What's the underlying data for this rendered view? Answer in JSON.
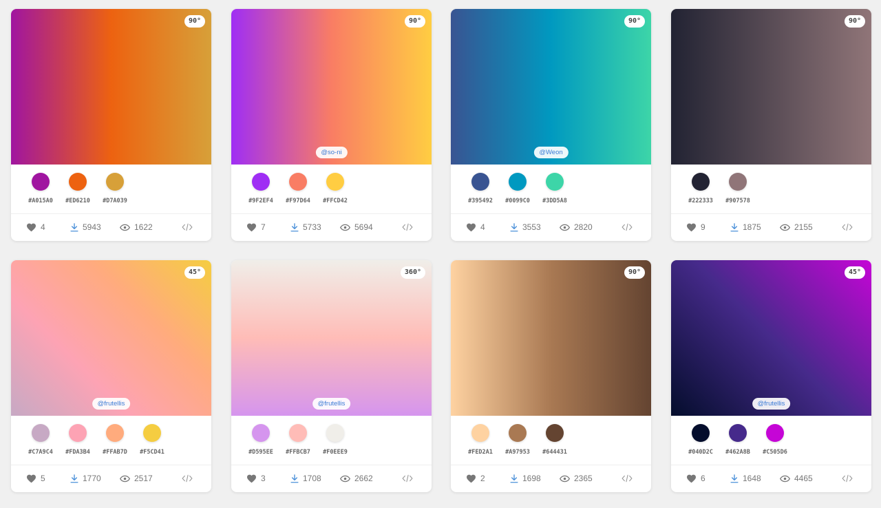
{
  "cards": [
    {
      "angle": "90°",
      "author": "",
      "gradient": "linear-gradient(90deg,#A015A0,#ED6210,#D7A039)",
      "colors": [
        {
          "hex": "#A015A0"
        },
        {
          "hex": "#ED6210"
        },
        {
          "hex": "#D7A039"
        }
      ],
      "likes": "4",
      "downloads": "5943",
      "views": "1622"
    },
    {
      "angle": "90°",
      "author": "@so-ni",
      "gradient": "linear-gradient(90deg,#9F2EF4,#F97D64,#FFCD42)",
      "colors": [
        {
          "hex": "#9F2EF4"
        },
        {
          "hex": "#F97D64"
        },
        {
          "hex": "#FFCD42"
        }
      ],
      "likes": "7",
      "downloads": "5733",
      "views": "5694"
    },
    {
      "angle": "90°",
      "author": "@Weon",
      "gradient": "linear-gradient(90deg,#395492,#0099C0,#3DD5A8)",
      "colors": [
        {
          "hex": "#395492"
        },
        {
          "hex": "#0099C0"
        },
        {
          "hex": "#3DD5A8"
        }
      ],
      "likes": "4",
      "downloads": "3553",
      "views": "2820"
    },
    {
      "angle": "90°",
      "author": "",
      "gradient": "linear-gradient(90deg,#222333,#907578)",
      "colors": [
        {
          "hex": "#222333"
        },
        {
          "hex": "#907578"
        }
      ],
      "likes": "9",
      "downloads": "1875",
      "views": "2155"
    },
    {
      "angle": "45°",
      "author": "@frutellis",
      "gradient": "linear-gradient(45deg,#C7A9C4,#FDA3B4,#FFAB7D,#F5CD41)",
      "colors": [
        {
          "hex": "#C7A9C4"
        },
        {
          "hex": "#FDA3B4"
        },
        {
          "hex": "#FFAB7D"
        },
        {
          "hex": "#F5CD41"
        }
      ],
      "likes": "5",
      "downloads": "1770",
      "views": "2517"
    },
    {
      "angle": "360°",
      "author": "@frutellis",
      "gradient": "linear-gradient(360deg,#D595EE,#FFBCB7,#F0EEE9)",
      "colors": [
        {
          "hex": "#D595EE"
        },
        {
          "hex": "#FFBCB7"
        },
        {
          "hex": "#F0EEE9"
        }
      ],
      "likes": "3",
      "downloads": "1708",
      "views": "2662"
    },
    {
      "angle": "90°",
      "author": "",
      "gradient": "linear-gradient(90deg,#FED2A1,#A97953,#644431)",
      "colors": [
        {
          "hex": "#FED2A1"
        },
        {
          "hex": "#A97953"
        },
        {
          "hex": "#644431"
        }
      ],
      "likes": "2",
      "downloads": "1698",
      "views": "2365"
    },
    {
      "angle": "45°",
      "author": "@frutellis",
      "gradient": "linear-gradient(45deg,#040D2C,#462A8B,#C505D6)",
      "colors": [
        {
          "hex": "#040D2C"
        },
        {
          "hex": "#462A8B"
        },
        {
          "hex": "#C505D6"
        }
      ],
      "likes": "6",
      "downloads": "1648",
      "views": "4465"
    }
  ]
}
